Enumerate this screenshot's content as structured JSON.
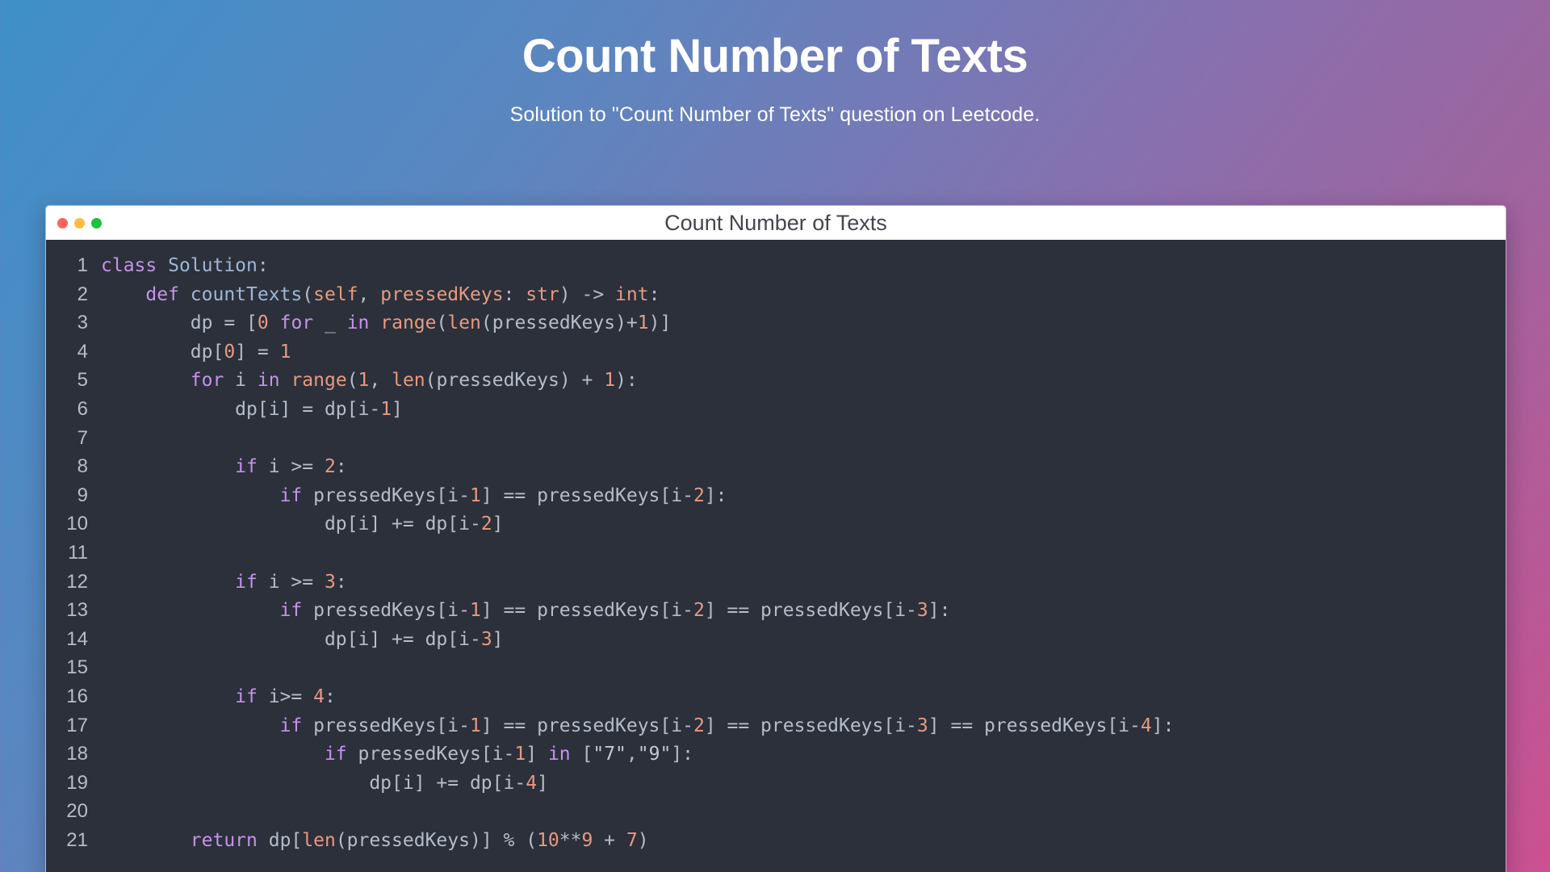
{
  "header": {
    "title": "Count Number of Texts",
    "subtitle": "Solution to \"Count Number of Texts\" question on Leetcode."
  },
  "window": {
    "title": "Count Number of Texts",
    "traffic_lights": [
      {
        "name": "close",
        "color": "#fc625d"
      },
      {
        "name": "minimize",
        "color": "#fdbc40"
      },
      {
        "name": "zoom",
        "color": "#1ec13c"
      }
    ],
    "background": "#2b303b",
    "titlebar_background": "#ffffff"
  },
  "theme": {
    "gradient_start": "#3f90c8",
    "gradient_mid": "#8a6fae",
    "gradient_end": "#cc5090",
    "keyword": "#c792ea",
    "builtin": "#e79a80",
    "number": "#e79a80",
    "plain": "#b6bdca",
    "funcname": "#a0b6d6",
    "linenumber": "#b6bdca"
  },
  "code": {
    "language": "python",
    "line_numbers": [
      "1",
      "2",
      "3",
      "4",
      "5",
      "6",
      "7",
      "8",
      "9",
      "10",
      "11",
      "12",
      "13",
      "14",
      "15",
      "16",
      "17",
      "18",
      "19",
      "20",
      "21"
    ],
    "lines": [
      {
        "n": "1",
        "text": "class Solution:"
      },
      {
        "n": "2",
        "text": "    def countTexts(self, pressedKeys: str) -> int:"
      },
      {
        "n": "3",
        "text": "        dp = [0 for _ in range(len(pressedKeys)+1)]"
      },
      {
        "n": "4",
        "text": "        dp[0] = 1"
      },
      {
        "n": "5",
        "text": "        for i in range(1, len(pressedKeys) + 1):"
      },
      {
        "n": "6",
        "text": "            dp[i] = dp[i-1]"
      },
      {
        "n": "7",
        "text": ""
      },
      {
        "n": "8",
        "text": "            if i >= 2:"
      },
      {
        "n": "9",
        "text": "                if pressedKeys[i-1] == pressedKeys[i-2]:"
      },
      {
        "n": "10",
        "text": "                    dp[i] += dp[i-2]"
      },
      {
        "n": "11",
        "text": ""
      },
      {
        "n": "12",
        "text": "            if i >= 3:"
      },
      {
        "n": "13",
        "text": "                if pressedKeys[i-1] == pressedKeys[i-2] == pressedKeys[i-3]:"
      },
      {
        "n": "14",
        "text": "                    dp[i] += dp[i-3]"
      },
      {
        "n": "15",
        "text": ""
      },
      {
        "n": "16",
        "text": "            if i>= 4:"
      },
      {
        "n": "17",
        "text": "                if pressedKeys[i-1] == pressedKeys[i-2] == pressedKeys[i-3] == pressedKeys[i-4]:"
      },
      {
        "n": "18",
        "text": "                    if pressedKeys[i-1] in [\"7\",\"9\"]:"
      },
      {
        "n": "19",
        "text": "                        dp[i] += dp[i-4]"
      },
      {
        "n": "20",
        "text": ""
      },
      {
        "n": "21",
        "text": "        return dp[len(pressedKeys)] % (10**9 + 7)"
      }
    ],
    "tokens": [
      [
        {
          "t": "class ",
          "c": "kw"
        },
        {
          "t": "Solution",
          "c": "fn"
        },
        {
          "t": ":",
          "c": "pl"
        }
      ],
      [
        {
          "t": "    ",
          "c": "pl"
        },
        {
          "t": "def ",
          "c": "kw"
        },
        {
          "t": "countTexts",
          "c": "fn"
        },
        {
          "t": "(",
          "c": "pl"
        },
        {
          "t": "self",
          "c": "par"
        },
        {
          "t": ", ",
          "c": "pl"
        },
        {
          "t": "pressedKeys",
          "c": "par"
        },
        {
          "t": ": ",
          "c": "pl"
        },
        {
          "t": "str",
          "c": "bi"
        },
        {
          "t": ") -> ",
          "c": "pl"
        },
        {
          "t": "int",
          "c": "bi"
        },
        {
          "t": ":",
          "c": "pl"
        }
      ],
      [
        {
          "t": "        dp = [",
          "c": "pl"
        },
        {
          "t": "0",
          "c": "num"
        },
        {
          "t": " ",
          "c": "pl"
        },
        {
          "t": "for",
          "c": "kw"
        },
        {
          "t": " _ ",
          "c": "pl"
        },
        {
          "t": "in",
          "c": "kw"
        },
        {
          "t": " ",
          "c": "pl"
        },
        {
          "t": "range",
          "c": "bi"
        },
        {
          "t": "(",
          "c": "pl"
        },
        {
          "t": "len",
          "c": "bi"
        },
        {
          "t": "(pressedKeys)+",
          "c": "pl"
        },
        {
          "t": "1",
          "c": "num"
        },
        {
          "t": ")]",
          "c": "pl"
        }
      ],
      [
        {
          "t": "        dp[",
          "c": "pl"
        },
        {
          "t": "0",
          "c": "num"
        },
        {
          "t": "] = ",
          "c": "pl"
        },
        {
          "t": "1",
          "c": "num"
        }
      ],
      [
        {
          "t": "        ",
          "c": "pl"
        },
        {
          "t": "for",
          "c": "kw"
        },
        {
          "t": " i ",
          "c": "pl"
        },
        {
          "t": "in",
          "c": "kw"
        },
        {
          "t": " ",
          "c": "pl"
        },
        {
          "t": "range",
          "c": "bi"
        },
        {
          "t": "(",
          "c": "pl"
        },
        {
          "t": "1",
          "c": "num"
        },
        {
          "t": ", ",
          "c": "pl"
        },
        {
          "t": "len",
          "c": "bi"
        },
        {
          "t": "(pressedKeys) + ",
          "c": "pl"
        },
        {
          "t": "1",
          "c": "num"
        },
        {
          "t": "):",
          "c": "pl"
        }
      ],
      [
        {
          "t": "            dp[i] = dp[i-",
          "c": "pl"
        },
        {
          "t": "1",
          "c": "num"
        },
        {
          "t": "]",
          "c": "pl"
        }
      ],
      [
        {
          "t": "",
          "c": "pl"
        }
      ],
      [
        {
          "t": "            ",
          "c": "pl"
        },
        {
          "t": "if",
          "c": "kw"
        },
        {
          "t": " i >= ",
          "c": "pl"
        },
        {
          "t": "2",
          "c": "num"
        },
        {
          "t": ":",
          "c": "pl"
        }
      ],
      [
        {
          "t": "                ",
          "c": "pl"
        },
        {
          "t": "if",
          "c": "kw"
        },
        {
          "t": " pressedKeys[i-",
          "c": "pl"
        },
        {
          "t": "1",
          "c": "num"
        },
        {
          "t": "] == pressedKeys[i-",
          "c": "pl"
        },
        {
          "t": "2",
          "c": "num"
        },
        {
          "t": "]:",
          "c": "pl"
        }
      ],
      [
        {
          "t": "                    dp[i] += dp[i-",
          "c": "pl"
        },
        {
          "t": "2",
          "c": "num"
        },
        {
          "t": "]",
          "c": "pl"
        }
      ],
      [
        {
          "t": "",
          "c": "pl"
        }
      ],
      [
        {
          "t": "            ",
          "c": "pl"
        },
        {
          "t": "if",
          "c": "kw"
        },
        {
          "t": " i >= ",
          "c": "pl"
        },
        {
          "t": "3",
          "c": "num"
        },
        {
          "t": ":",
          "c": "pl"
        }
      ],
      [
        {
          "t": "                ",
          "c": "pl"
        },
        {
          "t": "if",
          "c": "kw"
        },
        {
          "t": " pressedKeys[i-",
          "c": "pl"
        },
        {
          "t": "1",
          "c": "num"
        },
        {
          "t": "] == pressedKeys[i-",
          "c": "pl"
        },
        {
          "t": "2",
          "c": "num"
        },
        {
          "t": "] == pressedKeys[i-",
          "c": "pl"
        },
        {
          "t": "3",
          "c": "num"
        },
        {
          "t": "]:",
          "c": "pl"
        }
      ],
      [
        {
          "t": "                    dp[i] += dp[i-",
          "c": "pl"
        },
        {
          "t": "3",
          "c": "num"
        },
        {
          "t": "]",
          "c": "pl"
        }
      ],
      [
        {
          "t": "",
          "c": "pl"
        }
      ],
      [
        {
          "t": "            ",
          "c": "pl"
        },
        {
          "t": "if",
          "c": "kw"
        },
        {
          "t": " i>= ",
          "c": "pl"
        },
        {
          "t": "4",
          "c": "num"
        },
        {
          "t": ":",
          "c": "pl"
        }
      ],
      [
        {
          "t": "                ",
          "c": "pl"
        },
        {
          "t": "if",
          "c": "kw"
        },
        {
          "t": " pressedKeys[i-",
          "c": "pl"
        },
        {
          "t": "1",
          "c": "num"
        },
        {
          "t": "] == pressedKeys[i-",
          "c": "pl"
        },
        {
          "t": "2",
          "c": "num"
        },
        {
          "t": "] == pressedKeys[i-",
          "c": "pl"
        },
        {
          "t": "3",
          "c": "num"
        },
        {
          "t": "] == pressedKeys[i-",
          "c": "pl"
        },
        {
          "t": "4",
          "c": "num"
        },
        {
          "t": "]:",
          "c": "pl"
        }
      ],
      [
        {
          "t": "                    ",
          "c": "pl"
        },
        {
          "t": "if",
          "c": "kw"
        },
        {
          "t": " pressedKeys[i-",
          "c": "pl"
        },
        {
          "t": "1",
          "c": "num"
        },
        {
          "t": "] ",
          "c": "pl"
        },
        {
          "t": "in",
          "c": "kw"
        },
        {
          "t": " [",
          "c": "pl"
        },
        {
          "t": "\"7\"",
          "c": "str"
        },
        {
          "t": ",",
          "c": "pl"
        },
        {
          "t": "\"9\"",
          "c": "str"
        },
        {
          "t": "]:",
          "c": "pl"
        }
      ],
      [
        {
          "t": "                        dp[i] += dp[i-",
          "c": "pl"
        },
        {
          "t": "4",
          "c": "num"
        },
        {
          "t": "]",
          "c": "pl"
        }
      ],
      [
        {
          "t": "",
          "c": "pl"
        }
      ],
      [
        {
          "t": "        ",
          "c": "pl"
        },
        {
          "t": "return",
          "c": "kw"
        },
        {
          "t": " dp[",
          "c": "pl"
        },
        {
          "t": "len",
          "c": "bi"
        },
        {
          "t": "(pressedKeys)] % (",
          "c": "pl"
        },
        {
          "t": "10",
          "c": "num"
        },
        {
          "t": "**",
          "c": "pl"
        },
        {
          "t": "9",
          "c": "num"
        },
        {
          "t": " + ",
          "c": "pl"
        },
        {
          "t": "7",
          "c": "num"
        },
        {
          "t": ")",
          "c": "pl"
        }
      ]
    ]
  }
}
